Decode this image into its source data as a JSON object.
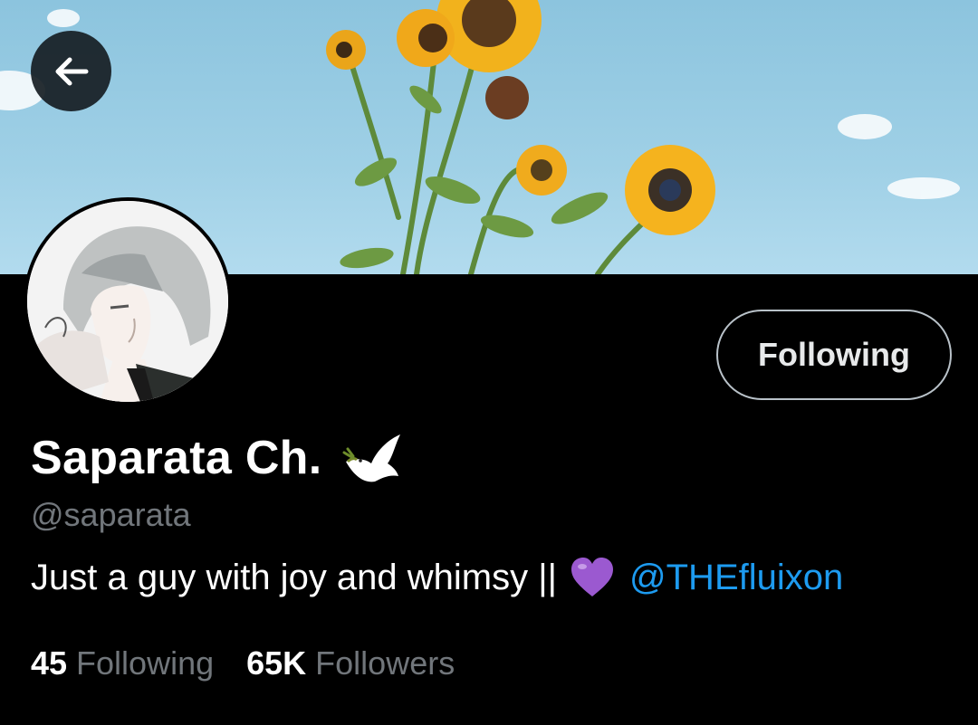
{
  "profile": {
    "display_name": "Saparata Ch.",
    "name_emoji": "dove-emoji",
    "handle": "@saparata",
    "bio_text": "Just a guy with joy and whimsy ||",
    "bio_emoji": "purple-heart-emoji",
    "bio_mention": "@THEfluixon"
  },
  "actions": {
    "follow_label": "Following",
    "back_icon": "arrow-left-icon"
  },
  "stats": {
    "following_count": "45",
    "following_label": "Following",
    "followers_count": "65K",
    "followers_label": "Followers"
  },
  "colors": {
    "background": "#000000",
    "text_primary": "#ffffff",
    "text_secondary": "#71767b",
    "link": "#1d9bf0",
    "button_border": "#b9c2c9",
    "banner_sky": "#9fd0e6"
  }
}
